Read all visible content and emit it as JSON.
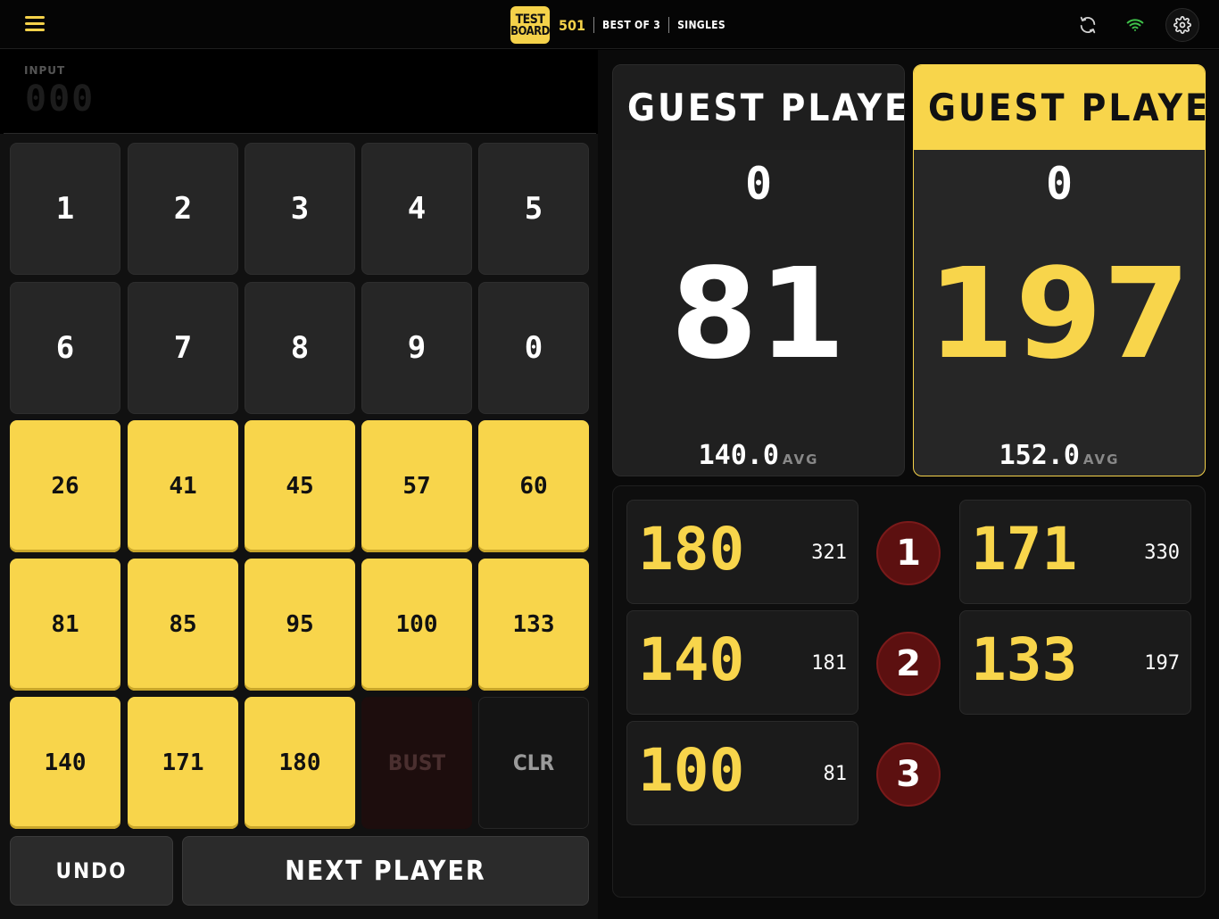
{
  "header": {
    "logo_line1": "TEST",
    "logo_line2": "BOARD",
    "game_type": "501",
    "format": "BEST OF 3",
    "mode": "SINGLES"
  },
  "input": {
    "label": "INPUT",
    "value": "000"
  },
  "keypad": {
    "digits": [
      "1",
      "2",
      "3",
      "4",
      "5",
      "6",
      "7",
      "8",
      "9",
      "0"
    ],
    "quick_scores": [
      "26",
      "41",
      "45",
      "57",
      "60",
      "81",
      "85",
      "95",
      "100",
      "133",
      "140",
      "171",
      "180"
    ],
    "bust_label": "BUST",
    "clear_label": "CLR",
    "undo_label": "UNDO",
    "next_label": "NEXT PLAYER"
  },
  "players": [
    {
      "name": "GUEST PLAYE...",
      "legs": "0",
      "score": "81",
      "avg": "140.0",
      "avg_unit": "AVG"
    },
    {
      "name": "GUEST PLAYE...",
      "legs": "0",
      "score": "197",
      "avg": "152.0",
      "avg_unit": "AVG"
    }
  ],
  "history": {
    "player1": [
      {
        "points": "180",
        "remaining": "321"
      },
      {
        "points": "140",
        "remaining": "181"
      },
      {
        "points": "100",
        "remaining": "81"
      }
    ],
    "rounds": [
      "1",
      "2",
      "3"
    ],
    "player2": [
      {
        "points": "171",
        "remaining": "330"
      },
      {
        "points": "133",
        "remaining": "197"
      }
    ]
  },
  "colors": {
    "accent": "#f8d54b",
    "badge": "#5c1010",
    "wifi": "#3fc34a"
  }
}
